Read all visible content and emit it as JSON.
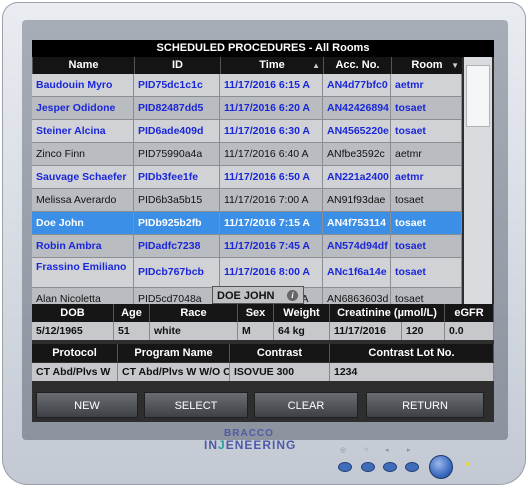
{
  "window": {
    "title": "SCHEDULED PROCEDURES - All Rooms"
  },
  "columns": [
    "Name",
    "ID",
    "Time",
    "Acc. No.",
    "Room"
  ],
  "rows": [
    {
      "name": "Baudouin Myro",
      "id": "PID75dc1c1c",
      "time": "11/17/2016 6:15 A",
      "acc": "AN4d77bfc0",
      "room": "aetmr"
    },
    {
      "name": "Jesper Odidone",
      "id": "PID82487dd5",
      "time": "11/17/2016 6:20 A",
      "acc": "AN42426894",
      "room": "tosaet"
    },
    {
      "name": "Steiner Alcina",
      "id": "PID6ade409d",
      "time": "11/17/2016 6:30 A",
      "acc": "AN4565220e",
      "room": "tosaet"
    },
    {
      "name": "Zinco Finn",
      "id": "PID75990a4a",
      "time": "11/17/2016 6:40 A",
      "acc": "ANfbe3592c",
      "room": "aetmr"
    },
    {
      "name": "Sauvage Schaefer",
      "id": "PIDb3fee1fe",
      "time": "11/17/2016 6:50 A",
      "acc": "AN221a2400",
      "room": "aetmr"
    },
    {
      "name": "Melissa Averardo",
      "id": "PID6b3a5b15",
      "time": "11/17/2016 7:00 A",
      "acc": "AN91f93dae",
      "room": "tosaet"
    },
    {
      "name": "Doe John",
      "id": "PIDb925b2fb",
      "time": "11/17/2016 7:15 A",
      "acc": "AN4f753114",
      "room": "tosaet"
    },
    {
      "name": "Robin Ambra",
      "id": "PIDadfc7238",
      "time": "11/17/2016 7:45 A",
      "acc": "AN574d94df",
      "room": "tosaet"
    },
    {
      "name": "Frassino Emiliano",
      "id": "PIDcb767bcb",
      "time": "11/17/2016 8:00 A",
      "acc": "ANc1f6a14e",
      "room": "tosaet"
    },
    {
      "name": "Alan Nicoletta",
      "id": "PID5cd7048a",
      "time": "11/17/2016 8:15 A",
      "acc": "AN6863603d",
      "room": "tosaet"
    }
  ],
  "selected_patient": "DOE JOHN",
  "details": {
    "headers1": [
      "DOB",
      "Age",
      "Race",
      "Sex",
      "Weight",
      "Creatinine (µmol/L)",
      "eGFR"
    ],
    "values1": {
      "dob": "5/12/1965",
      "age": "51",
      "race": "white",
      "sex": "M",
      "weight": "64 kg",
      "creat_date": "11/17/2016",
      "creat_value": "120",
      "egfr": "0.0"
    },
    "headers2": [
      "Protocol",
      "Program Name",
      "Contrast",
      "Contrast Lot No."
    ],
    "values2": {
      "protocol": "CT Abd/Plvs W",
      "program": "CT Abd/Plvs W W/O C",
      "contrast": "ISOVUE 300",
      "lot": "1234"
    }
  },
  "buttons": {
    "new": "NEW",
    "select": "SELECT",
    "clear": "CLEAR",
    "return": "RETURN"
  },
  "brand": {
    "line1": "BRACCO",
    "line2a": "IN",
    "line2b": "J",
    "line2c": "ENEERING"
  },
  "icons": {
    "sort_asc": "triangle-up",
    "filter": "triangle-down",
    "info": "i"
  },
  "colors": {
    "selected_row": "#3b8fe6",
    "link_text": "#1a27d9"
  }
}
